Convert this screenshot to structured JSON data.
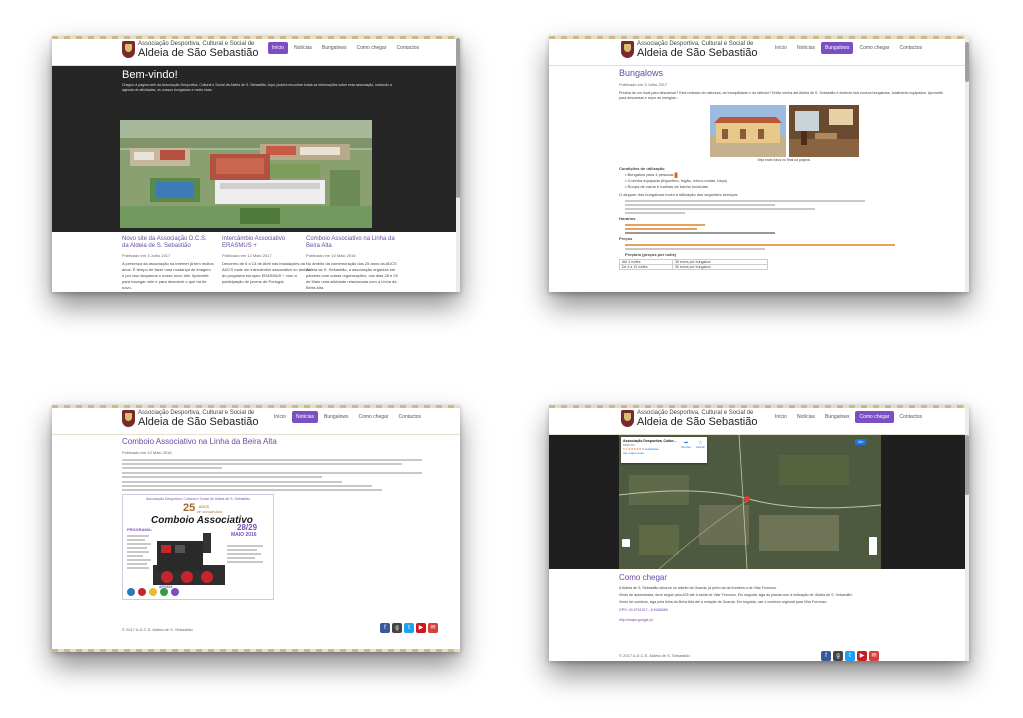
{
  "site": {
    "brand_line1": "Associação Desportiva, Cultural e Social de",
    "brand_line2": "Aldeia de São Sebastião",
    "nav": [
      "Início",
      "Notícias",
      "Bungalows",
      "Como chegar",
      "Contactos"
    ]
  },
  "home": {
    "hero_title": "Bem-vindo!",
    "hero_text": "Chegou à página web da Associação Desportiva, Cultural e Social da Aldeia de S. Sebastião. Aqui, poderá encontrar todas as informações sobre esta associação, incluindo a agenda de atividades, os nossos bungalows e muito mais.",
    "articles": [
      {
        "title": "Novo site da Associação D.C.S. da Aldeia de S. Sebastião",
        "date": "Publicado em 3 Julho 2017",
        "text": "A presença da associação na internet já tem muitos anos. É tempo de fazer uma mudança de imagem e por isso lançamos o nosso novo site. Aproveite para navegar nele e para descobrir o que há de novo."
      },
      {
        "title": "Intercâmbio Associativo ERASMUS +",
        "date": "Publicado em 12 Maio 2017",
        "text": "Decorreu de 6 a 13 de Abril nas instalações da ADCS mais um intercâmbio associativo no âmbito do programa europeu ERASMUS + com a participação de jovens de Portugal."
      },
      {
        "title": "Comboio Associativo na Linha da Beira Alta",
        "date": "Publicado em 10 Maio 2016",
        "text": "No âmbito da comemoração dos 25 anos da ADCS Aldeia de S. Sebastião, a associação organiza em parceria com outras organizações, nos dias 28 e 29 de Maio uma atividade relacionada com a Linha da Beira Alta."
      }
    ]
  },
  "bungalows": {
    "title": "Bungalows",
    "date": "Publicado em 3 Julho 2017",
    "intro": "Precisa de um local para descansar? Está rodeado de natureza, de tranquilidade e do silêncio? Então venha até Aldeia de S. Sebastião e desfrute dos nossos bungalows, totalmente equipados. Aproveite para descansar e repor as energias...",
    "caption": "Veja mais fotos no final da página.",
    "conditions_title": "Condições de utilização",
    "conditions": [
      "Bungalow para 4 pessoas",
      "Cozinha equipada (frigorífico, fogão, micro-ondas, loiça)",
      "Roupa de cama e toalhas de banho incluídas"
    ],
    "services_title": "O aluguer dos bungalows inclui a utilização dos seguintes serviços:",
    "hours_title": "Horários",
    "prices_title": "Preços",
    "table_title": "Preçário (preços por noite)",
    "table": [
      [
        "Até 3 noites",
        "35 euros por bungalow"
      ],
      [
        "De 4 a 10 noites",
        "30 euros por bungalow"
      ]
    ]
  },
  "news": {
    "title": "Comboio Associativo na Linha da Beira Alta",
    "date": "Publicado em 10 Maio 2016",
    "poster_header": "Associação Desportiva, Cultural e Social de Aldeia de S. Sebastião",
    "poster_anniv": "25",
    "poster_anos": "ANOS",
    "poster_anniv_label": "25º ANIVERSÁRIO",
    "poster_title": "Comboio Associativo",
    "poster_dates": "28/29",
    "poster_month": "MAIO 2016",
    "poster_programa": "PROGRAMA:",
    "poster_org": "APOIOS",
    "footer": "© 2017 A.D.C.S. Aldeia de S. Sebastião"
  },
  "directions": {
    "map_place_title": "Associação Desportiva, Cultur...",
    "map_place_sub": "6355 SS",
    "map_reviews": "5 avaliações",
    "map_rating": "5,0",
    "map_link": "Ver mapa maior",
    "map_directions": "Direções",
    "map_save": "Guardar",
    "map_view": "Ver",
    "title": "Como chegar",
    "intro": "A Aldeia de S. Sebastião situa-se no distrito da Guarda, já perto da da fronteira a de Vilar Formoso.",
    "p2": "Vindo de autoestrada, deve seguir pela A25 até à saída de Vilar Formoso. Em seguida, siga as placas com a indicação de 'Aldeia de S. Sebastião'.",
    "p3": "Vindo de comboio, siga pela linha da Beira Alta até à estação de Guarda. Em seguida, use o comboio regional para Vilar Formoso.",
    "coords": "GPS: 40.5751917, -6.9268469",
    "link": "http://maps.google.pt",
    "footer": "© 2017 A.D.C.S. Aldeia de S. Sebastião"
  },
  "colors": {
    "accent": "#7b4fc3",
    "link": "#6a4aa0",
    "highlight": "#e06010"
  }
}
